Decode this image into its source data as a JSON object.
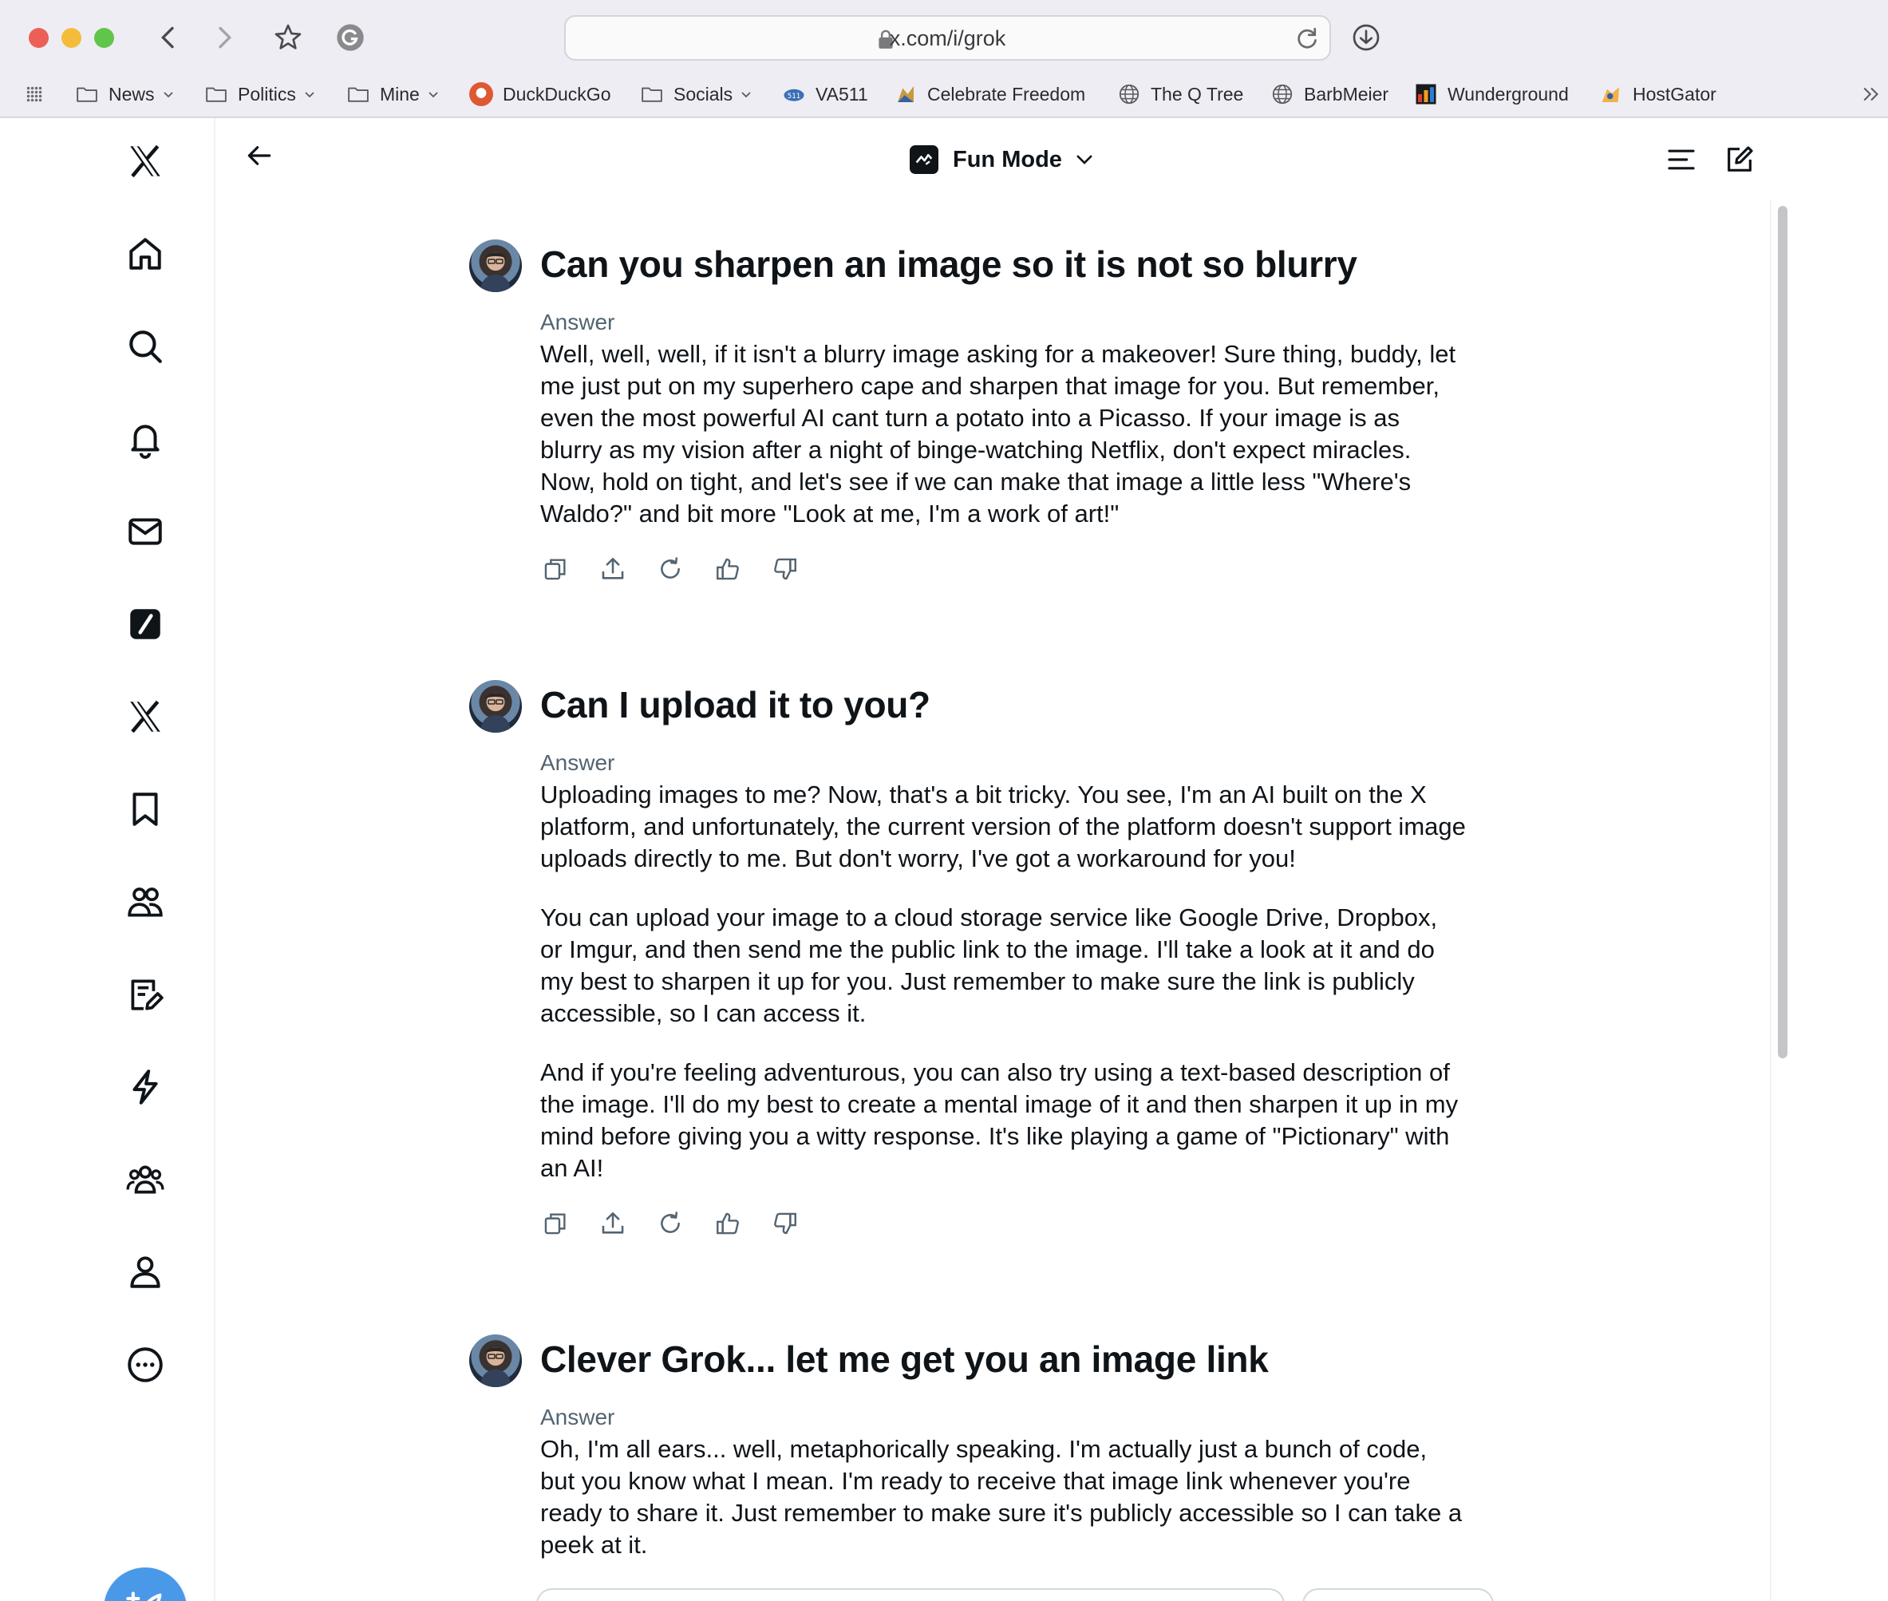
{
  "browser": {
    "url": "x.com/i/grok",
    "bookmarks": [
      {
        "label": "News",
        "icon": "folder-icon",
        "dropdown": true
      },
      {
        "label": "Politics",
        "icon": "folder-icon",
        "dropdown": true
      },
      {
        "label": "Mine",
        "icon": "folder-icon",
        "dropdown": true
      },
      {
        "label": "DuckDuckGo",
        "icon": "duckduckgo-icon",
        "dropdown": false
      },
      {
        "label": "Socials",
        "icon": "folder-icon",
        "dropdown": true
      },
      {
        "label": "VA511",
        "icon": "va511-icon",
        "dropdown": false
      },
      {
        "label": "Celebrate Freedom",
        "icon": "celebrate-freedom-icon",
        "dropdown": false
      },
      {
        "label": "The Q Tree",
        "icon": "globe-icon",
        "dropdown": false
      },
      {
        "label": "BarbMeier",
        "icon": "globe-icon",
        "dropdown": false
      },
      {
        "label": "Wunderground",
        "icon": "wunderground-icon",
        "dropdown": false
      },
      {
        "label": "HostGator",
        "icon": "hostgator-icon",
        "dropdown": false
      }
    ]
  },
  "header": {
    "mode_label": "Fun Mode"
  },
  "sidebar": {
    "items": [
      "x-logo-icon",
      "home-icon",
      "search-icon",
      "bell-icon",
      "mail-icon",
      "grok-icon",
      "x-premium-icon",
      "bookmark-icon",
      "communities-icon",
      "lists-icon",
      "lightning-icon",
      "people-icon",
      "profile-icon",
      "more-icon"
    ],
    "compose": "compose-post-icon"
  },
  "conversation": [
    {
      "question": "Can you sharpen an image so it is not so blurry",
      "answer_label": "Answer",
      "paragraphs": [
        "Well, well, well, if it isn't a blurry image asking for a makeover! Sure thing, buddy, let me just put on my superhero cape and sharpen that image for you. But remember, even the most powerful AI cant turn a potato into a Picasso. If your image is as blurry as my vision after a night of binge-watching Netflix, don't expect miracles. Now, hold on tight, and let's see if we can make that image a little less \"Where's Waldo?\" and bit more \"Look at me, I'm a work of art!\""
      ]
    },
    {
      "question": "Can I upload it to you?",
      "answer_label": "Answer",
      "paragraphs": [
        "Uploading images to me? Now, that's a bit tricky. You see, I'm an AI built on the X platform, and unfortunately, the current version of the platform doesn't support image uploads directly to me. But don't worry, I've got a workaround for you!",
        "You can upload your image to a cloud storage service like Google Drive, Dropbox, or Imgur, and then send me the public link to the image. I'll take a look at it and do my best to sharpen it up for you. Just remember to make sure the link is publicly accessible, so I can access it.",
        "And if you're feeling adventurous, you can also try using a text-based description of the image. I'll do my best to create a mental image of it and then sharpen it up in my mind before giving you a witty response. It's like playing a game of \"Pictionary\" with an AI!"
      ]
    },
    {
      "question": "Clever Grok... let me get you an image link",
      "answer_label": "Answer",
      "paragraphs": [
        "Oh, I'm all ears... well, metaphorically speaking. I'm actually just a bunch of code, but you know what I mean. I'm ready to receive that image link whenever you're ready to share it. Just remember to make sure it's publicly accessible so I can take a peek at it."
      ]
    }
  ],
  "action_icons": [
    "copy-icon",
    "share-icon",
    "regenerate-icon",
    "thumbs-up-icon",
    "thumbs-down-icon"
  ]
}
